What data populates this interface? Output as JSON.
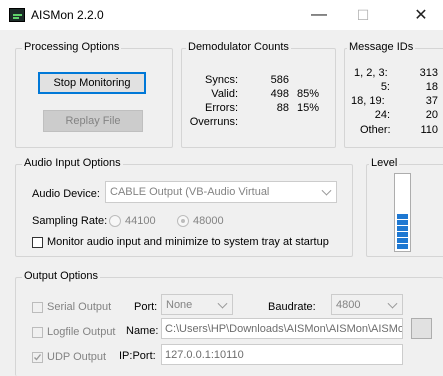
{
  "window": {
    "title": "AISMon 2.2.0",
    "minimize": "—",
    "maximize": "☐",
    "close": "✕"
  },
  "processing": {
    "legend": "Processing Options",
    "stop_button": "Stop Monitoring",
    "replay_button": "Replay File"
  },
  "demod": {
    "legend": "Demodulator Counts",
    "rows": [
      {
        "label": "Syncs:",
        "count": "586",
        "pct": ""
      },
      {
        "label": "Valid:",
        "count": "498",
        "pct": "85%"
      },
      {
        "label": "Errors:",
        "count": "88",
        "pct": "15%"
      },
      {
        "label": "Overruns:",
        "count": "",
        "pct": ""
      }
    ]
  },
  "message_ids": {
    "legend": "Message IDs",
    "rows": [
      {
        "label": "1, 2, 3:",
        "count": "313"
      },
      {
        "label": "5:",
        "count": "18"
      },
      {
        "label": "18, 19:",
        "count": "37"
      },
      {
        "label": "24:",
        "count": "20"
      },
      {
        "label": "Other:",
        "count": "110"
      }
    ]
  },
  "audio": {
    "legend": "Audio Input Options",
    "device_label": "Audio Device:",
    "device_value": "CABLE Output (VB-Audio Virtual",
    "rate_label": "Sampling Rate:",
    "rate_options": [
      "44100",
      "48000"
    ],
    "rate_selected": "48000",
    "monitor_label": "Monitor audio input and minimize to system tray at startup"
  },
  "level": {
    "legend": "Level",
    "value_fraction": 0.5
  },
  "output": {
    "legend": "Output Options",
    "serial_label": "Serial Output",
    "logfile_label": "Logfile Output",
    "udp_label": "UDP Output",
    "port_label": "Port:",
    "port_value": "None",
    "baud_label": "Baudrate:",
    "baud_value": "4800",
    "name_label": "Name:",
    "name_value": "C:\\Users\\HP\\Downloads\\AISMon\\AISMon\\AISMo",
    "browse_label": "",
    "ipport_label": "IP:Port:",
    "ipport_value": "127.0.0.1:10110"
  },
  "colors": {
    "focus": "#0078d7",
    "level_bar": "#1e78d2",
    "window_bg": "#f0f0f0"
  }
}
